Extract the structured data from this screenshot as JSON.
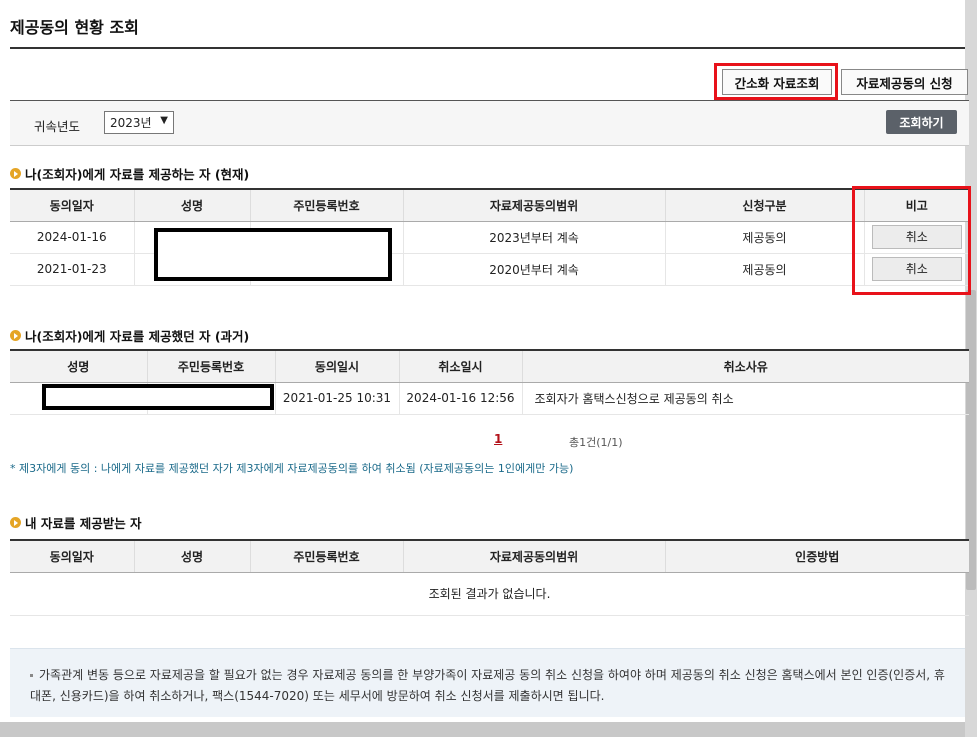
{
  "page": {
    "title": "제공동의 현황 조회"
  },
  "tabs": [
    {
      "label": "간소화 자료조회"
    },
    {
      "label": "자료제공동의 신청"
    }
  ],
  "search": {
    "year_label": "귀속년도",
    "year_value": "2023년",
    "button_label": "조회하기"
  },
  "section_current": {
    "title": "나(조회자)에게 자료를 제공하는 자 (현재)",
    "headers": [
      "동의일자",
      "성명",
      "주민등록번호",
      "자료제공동의범위",
      "신청구분",
      "비고"
    ],
    "rows": [
      {
        "date": "2024-01-16",
        "scope": "2023년부터 계속",
        "type": "제공동의",
        "action": "취소"
      },
      {
        "date": "2021-01-23",
        "scope": "2020년부터 계속",
        "type": "제공동의",
        "action": "취소"
      }
    ]
  },
  "section_past": {
    "title": "나(조회자)에게 자료를 제공했던 자 (과거)",
    "headers": [
      "성명",
      "주민등록번호",
      "동의일시",
      "취소일시",
      "취소사유"
    ],
    "rows": [
      {
        "agree_time": "2021-01-25 10:31",
        "cancel_time": "2024-01-16 12:56",
        "reason": "조회자가 홈택스신청으로 제공동의 취소"
      }
    ]
  },
  "pagination": {
    "current": "1",
    "total_text": "총1건(1/1)"
  },
  "note": "* 제3자에게 동의 : 나에게 자료를 제공했던 자가 제3자에게 자료제공동의를 하여 취소됨 (자료제공동의는 1인에게만 가능)",
  "section_receive": {
    "title": "내 자료를 제공받는 자",
    "headers": [
      "동의일자",
      "성명",
      "주민등록번호",
      "자료제공동의범위",
      "인증방법"
    ],
    "empty": "조회된 결과가 없습니다."
  },
  "info": {
    "text": "가족관계 변동 등으로 자료제공을 할 필요가 없는 경우 자료제공 동의를 한 부양가족이 자료제공 동의 취소 신청을 하여야 하며 제공동의 취소 신청은 홈택스에서 본인 인증(인증서, 휴대폰, 신용카드)을 하여 취소하거나, 팩스(1544-7020) 또는 세무서에 방문하여 취소 신청서를 제출하시면 됩니다."
  },
  "colors": {
    "highlight": "#e8121a",
    "bullet": "#e5a526",
    "search_button": "#5b6169",
    "note": "#1b6a8a"
  }
}
